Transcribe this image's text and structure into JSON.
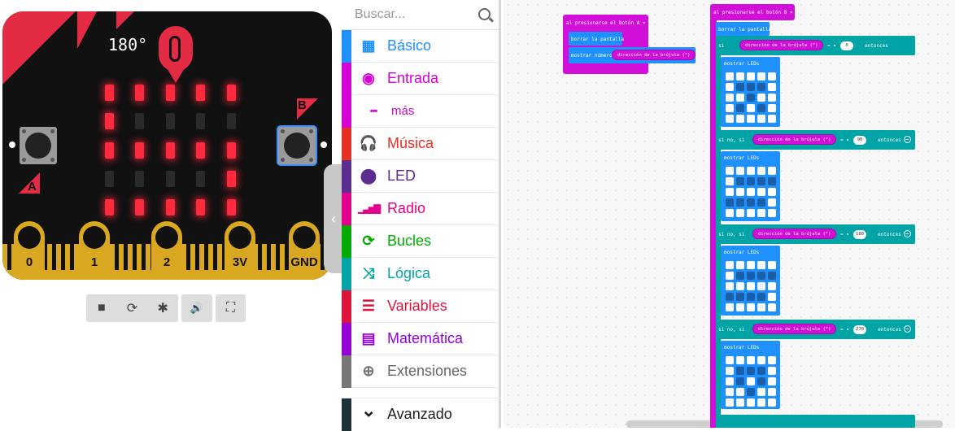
{
  "simulator": {
    "heading": "180°",
    "button_a": "A",
    "button_b": "B",
    "pins": [
      "0",
      "1",
      "2",
      "3V",
      "GND"
    ],
    "led_matrix": [
      [
        1,
        1,
        1,
        1,
        1
      ],
      [
        1,
        0,
        0,
        0,
        0
      ],
      [
        1,
        1,
        1,
        1,
        1
      ],
      [
        0,
        0,
        0,
        0,
        1
      ],
      [
        1,
        1,
        1,
        1,
        1
      ]
    ],
    "controls": {
      "stop": "■",
      "restart": "⟳",
      "debug": "✱",
      "sound": "🔊",
      "fullscreen": "⛶"
    }
  },
  "toolbox": {
    "search_placeholder": "Buscar...",
    "categories": [
      {
        "label": "Básico",
        "color": "#1e90ff",
        "icon": "grid-icon",
        "glyph": "▦"
      },
      {
        "label": "Entrada",
        "color": "#d400d4",
        "icon": "target-icon",
        "glyph": "◉"
      },
      {
        "label": "más",
        "color": "#d400d4",
        "icon": "dots-icon",
        "glyph": "•••"
      },
      {
        "label": "Música",
        "color": "#e63022",
        "icon": "headphones-icon",
        "glyph": "🎧"
      },
      {
        "label": "LED",
        "color": "#5c2d91",
        "icon": "toggle-icon",
        "glyph": "⬤"
      },
      {
        "label": "Radio",
        "color": "#e3008c",
        "icon": "signal-icon",
        "glyph": "▁▃▅▇"
      },
      {
        "label": "Bucles",
        "color": "#00aa00",
        "icon": "refresh-icon",
        "glyph": "⟳"
      },
      {
        "label": "Lógica",
        "color": "#00a4a6",
        "icon": "shuffle-icon",
        "glyph": "⤨"
      },
      {
        "label": "Variables",
        "color": "#dc143c",
        "icon": "list-icon",
        "glyph": "☰"
      },
      {
        "label": "Matemática",
        "color": "#9400d3",
        "icon": "calculator-icon",
        "glyph": "▤"
      },
      {
        "label": "Extensiones",
        "color": "#777777",
        "icon": "plus-circle-icon",
        "glyph": "⊕"
      }
    ],
    "advanced": {
      "label": "Avanzado",
      "glyph": "⌄"
    }
  },
  "workspace": {
    "event_a": {
      "title": "al presionarse el botón  A ▾",
      "clear": "borrar la pantalla",
      "show_number": "mostrar número",
      "compass": "dirección de la brújula (°)"
    },
    "event_b": {
      "title": "al presionarse el botón  B ▾",
      "clear": "borrar la pantalla",
      "if_label": "si",
      "else_if_label": "si no, si",
      "then_label": "entonces",
      "compass": "dirección de la brújula (°)",
      "op": "= ▾",
      "show_leds": "mostrar LEDs",
      "branches": [
        {
          "value": "0",
          "leds": [
            [
              1,
              1,
              1,
              1,
              1
            ],
            [
              1,
              0,
              0,
              0,
              1
            ],
            [
              1,
              1,
              0,
              1,
              1
            ],
            [
              1,
              0,
              1,
              0,
              1
            ],
            [
              1,
              1,
              1,
              1,
              1
            ]
          ]
        },
        {
          "value": "90",
          "leds": [
            [
              1,
              1,
              1,
              1,
              1
            ],
            [
              1,
              0,
              0,
              0,
              0
            ],
            [
              1,
              1,
              1,
              1,
              1
            ],
            [
              0,
              0,
              0,
              0,
              1
            ],
            [
              1,
              1,
              1,
              1,
              1
            ]
          ]
        },
        {
          "value": "180",
          "leds": [
            [
              1,
              1,
              1,
              1,
              1
            ],
            [
              1,
              0,
              0,
              0,
              0
            ],
            [
              1,
              1,
              1,
              1,
              1
            ],
            [
              0,
              0,
              0,
              0,
              1
            ],
            [
              1,
              1,
              1,
              1,
              1
            ]
          ]
        },
        {
          "value": "270",
          "leds": [
            [
              1,
              1,
              1,
              1,
              1
            ],
            [
              1,
              0,
              0,
              0,
              1
            ],
            [
              1,
              0,
              1,
              0,
              1
            ],
            [
              1,
              1,
              0,
              1,
              1
            ],
            [
              1,
              1,
              1,
              1,
              1
            ]
          ]
        }
      ]
    }
  }
}
